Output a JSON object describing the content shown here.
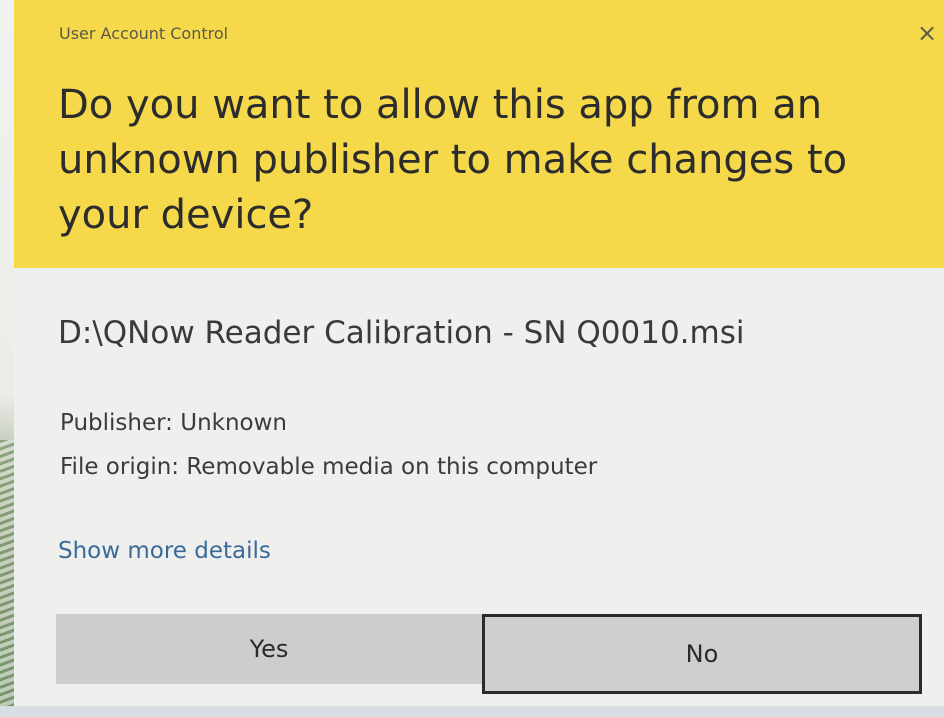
{
  "dialog": {
    "window_title": "User Account Control",
    "close_glyph": "×",
    "question": "Do you want to allow this app from an unknown publisher to make changes to your device?",
    "file_path": "D:\\QNow Reader Calibration - SN Q0010.msi",
    "publisher_line": "Publisher: Unknown",
    "file_origin_line": "File origin: Removable media on this computer",
    "show_more_details_label": "Show more details",
    "yes_label": "Yes",
    "no_label": "No"
  },
  "colors": {
    "header_background": "#f5d94a",
    "body_background": "#efefee",
    "link": "#3a6a9a",
    "button": "#cdcdcb"
  },
  "icons": {
    "close": "close-icon"
  }
}
